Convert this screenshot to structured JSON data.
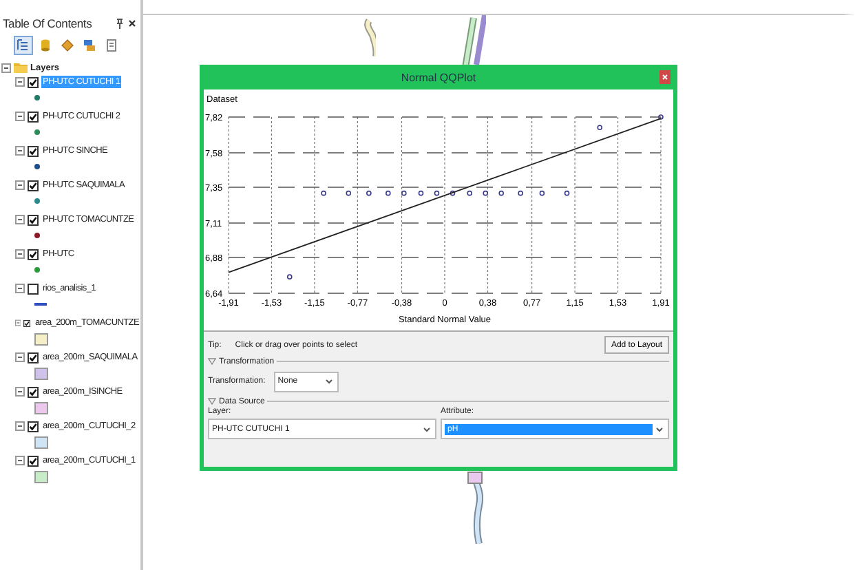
{
  "toc": {
    "title": "Table Of Contents",
    "tools": [
      {
        "selected": true
      },
      {
        "selected": false
      },
      {
        "selected": false
      },
      {
        "selected": false
      },
      {
        "selected": false
      }
    ],
    "root": {
      "label": "Layers",
      "expanded": true,
      "children": [
        {
          "label": "PH-UTC CUTUCHI 1",
          "checked": true,
          "selected": true,
          "symbol": {
            "kind": "point",
            "color": "#1f7a6a"
          }
        },
        {
          "label": "PH-UTC CUTUCHI 2",
          "checked": true,
          "selected": false,
          "symbol": {
            "kind": "point",
            "color": "#2e8b57"
          }
        },
        {
          "label": "PH-UTC SINCHE",
          "checked": true,
          "selected": false,
          "symbol": {
            "kind": "point",
            "color": "#1f4f8a"
          }
        },
        {
          "label": "PH-UTC SAQUIMALA",
          "checked": true,
          "selected": false,
          "symbol": {
            "kind": "point",
            "color": "#2a8a8a"
          }
        },
        {
          "label": "PH-UTC TOMACUNTZE",
          "checked": true,
          "selected": false,
          "symbol": {
            "kind": "point",
            "color": "#8b1a2a"
          }
        },
        {
          "label": "PH-UTC",
          "checked": true,
          "selected": false,
          "symbol": {
            "kind": "point",
            "color": "#2a9a3a"
          }
        },
        {
          "label": "rios_analisis_1",
          "checked": false,
          "selected": false,
          "symbol": {
            "kind": "line",
            "color": "#3050c0"
          }
        },
        {
          "label": "area_200m_TOMACUNTZE",
          "checked": true,
          "selected": false,
          "symbol": {
            "kind": "polygon",
            "color": "#f5efc8"
          }
        },
        {
          "label": "area_200m_SAQUIMALA",
          "checked": true,
          "selected": false,
          "symbol": {
            "kind": "polygon",
            "color": "#cfc3ec"
          }
        },
        {
          "label": "area_200m_ISINCHE",
          "checked": true,
          "selected": false,
          "symbol": {
            "kind": "polygon",
            "color": "#ecc8ec"
          }
        },
        {
          "label": "area_200m_CUTUCHI_2",
          "checked": true,
          "selected": false,
          "symbol": {
            "kind": "polygon",
            "color": "#cfe4f4"
          }
        },
        {
          "label": "area_200m_CUTUCHI_1",
          "checked": true,
          "selected": false,
          "symbol": {
            "kind": "polygon",
            "color": "#c8ecc8"
          }
        }
      ]
    }
  },
  "dialog": {
    "title": "Normal QQPlot",
    "chart": {
      "chart_data": {
        "type": "scatter",
        "ylabel": "Dataset",
        "xlabel": "Standard Normal Value",
        "series": [
          {
            "type": "scatter",
            "color": "#3a3a8a",
            "x": [
              -1.37,
              -1.07,
              -0.85,
              -0.67,
              -0.5,
              -0.36,
              -0.21,
              -0.07,
              0.07,
              0.22,
              0.36,
              0.5,
              0.67,
              0.86,
              1.08,
              1.37,
              1.91
            ],
            "values": [
              6.75,
              7.31,
              7.31,
              7.31,
              7.31,
              7.31,
              7.31,
              7.31,
              7.31,
              7.31,
              7.31,
              7.31,
              7.31,
              7.31,
              7.31,
              7.75,
              7.82
            ]
          },
          {
            "type": "line",
            "color": "#222222",
            "x": [
              -1.91,
              1.91
            ],
            "values": [
              6.78,
              7.81
            ]
          }
        ],
        "grid": true,
        "xlim": [
          -1.91,
          1.91
        ],
        "ylim": [
          6.64,
          7.82
        ],
        "xticks": [
          {
            "value": -1.91,
            "label": "-1,91"
          },
          {
            "value": -1.53,
            "label": "-1,53"
          },
          {
            "value": -1.15,
            "label": "-1,15"
          },
          {
            "value": -0.77,
            "label": "-0,77"
          },
          {
            "value": -0.38,
            "label": "-0,38"
          },
          {
            "value": 0,
            "label": "0"
          },
          {
            "value": 0.38,
            "label": "0,38"
          },
          {
            "value": 0.77,
            "label": "0,77"
          },
          {
            "value": 1.15,
            "label": "1,15"
          },
          {
            "value": 1.53,
            "label": "1,53"
          },
          {
            "value": 1.91,
            "label": "1,91"
          }
        ],
        "yticks": [
          {
            "value": 6.64,
            "label": "6,64"
          },
          {
            "value": 6.88,
            "label": "6,88"
          },
          {
            "value": 7.11,
            "label": "7,11"
          },
          {
            "value": 7.35,
            "label": "7,35"
          },
          {
            "value": 7.58,
            "label": "7,58"
          },
          {
            "value": 7.82,
            "label": "7,82"
          }
        ]
      }
    },
    "tip_label": "Tip:",
    "tip": "Click or drag over points to select",
    "add_button": "Add to Layout",
    "sections": [
      {
        "title": "Transformation",
        "expanded": true
      },
      {
        "title": "Data Source",
        "expanded": true
      }
    ],
    "transformation": {
      "label": "Transformation:",
      "value": "None"
    },
    "layer": {
      "label": "Layer:",
      "value": "PH-UTC CUTUCHI 1"
    },
    "attribute": {
      "label": "Attribute:",
      "value": "pH",
      "selected": true
    }
  }
}
